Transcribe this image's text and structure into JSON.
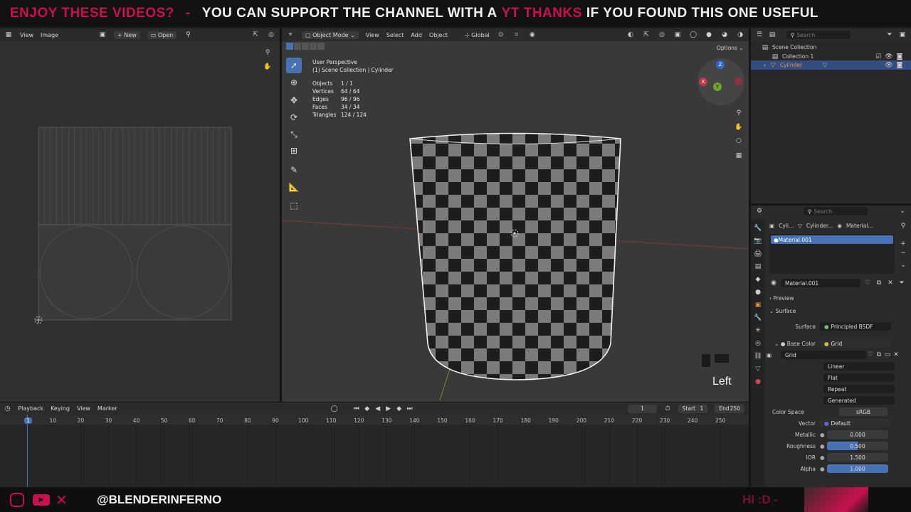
{
  "banner": {
    "left": "ENJOY THESE VIDEOS?",
    "sep": "-",
    "mid1": "YOU CAN SUPPORT THE CHANNEL WITH A",
    "highlight": "YT THANKS",
    "mid2": "IF YOU FOUND THIS ONE USEFUL"
  },
  "footer": {
    "handle": "@BLENDERINFERNO",
    "hi": "HI :D -"
  },
  "uv_editor": {
    "menu": [
      "View",
      "Image"
    ],
    "new_label": "New",
    "open_label": "Open"
  },
  "viewport": {
    "mode": "Object Mode",
    "menu": [
      "View",
      "Select",
      "Add",
      "Object"
    ],
    "orientation": "Global",
    "options_label": "Options",
    "perspective": "User Perspective",
    "collection_path": "(1) Scene Collection | Cylinder",
    "stats": [
      {
        "label": "Objects",
        "value": "1 / 1"
      },
      {
        "label": "Vertices",
        "value": "64 / 64"
      },
      {
        "label": "Edges",
        "value": "96 / 96"
      },
      {
        "label": "Faces",
        "value": "34 / 34"
      },
      {
        "label": "Triangles",
        "value": "124 / 124"
      }
    ],
    "overlay_word": "Left",
    "gizmo": {
      "z": "Z",
      "x": "X",
      "y": "Y"
    }
  },
  "outliner": {
    "search_placeholder": "Search",
    "scene_collection": "Scene Collection",
    "collection": "Collection 1",
    "object": "Cylinder"
  },
  "properties": {
    "search_placeholder": "Search",
    "breadcrumb": [
      "Cyli...",
      "Cylinder...",
      "Material..."
    ],
    "slot": "Material.001",
    "material_name": "Material.001",
    "preview_label": "Preview",
    "surface_panel": "Surface",
    "rows": {
      "surface_label": "Surface",
      "surface_value": "Principled BSDF",
      "base_color_label": "Base Color",
      "base_color_value": "Grid",
      "image_name": "Grid",
      "interp": "Linear",
      "projection": "Flat",
      "extension": "Repeat",
      "source": "Generated",
      "color_space_label": "Color Space",
      "color_space_value": "sRGB",
      "vector_label": "Vector",
      "vector_value": "Default",
      "metallic_label": "Metallic",
      "metallic_value": "0.000",
      "roughness_label": "Roughness",
      "roughness_value": "0.500",
      "ior_label": "IOR",
      "ior_value": "1.500",
      "alpha_label": "Alpha",
      "alpha_value": "1.000"
    },
    "roughness_fraction": 0.5,
    "alpha_fraction": 1.0
  },
  "timeline": {
    "menu": [
      "Playback",
      "Keying",
      "View",
      "Marker"
    ],
    "current_frame": "1",
    "start_label": "Start",
    "start_value": "1",
    "end_label": "End",
    "end_value": "250",
    "ruler": [
      "1",
      "10",
      "20",
      "30",
      "40",
      "50",
      "60",
      "70",
      "80",
      "90",
      "100",
      "110",
      "120",
      "130",
      "140",
      "150",
      "160",
      "170",
      "180",
      "190",
      "200",
      "210",
      "220",
      "230",
      "240",
      "250"
    ]
  },
  "colors": {
    "accent_pink": "#c9114d",
    "select_blue": "#4772b3",
    "viewport_bg": "#393939"
  }
}
